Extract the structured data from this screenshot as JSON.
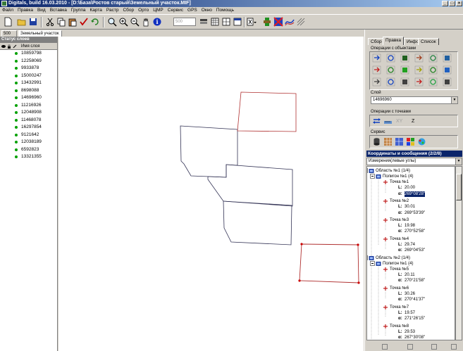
{
  "window": {
    "title": "Digitals, build 16.03.2010 - [D:\\База\\Ростов старый\\Земельный участок.MIF]"
  },
  "menu": [
    "Файл",
    "Правка",
    "Вид",
    "Вставка",
    "Группа",
    "Карта",
    "Растр",
    "Сбор",
    "Орто",
    "ЦМР",
    "Сервис",
    "GPS",
    "Окно",
    "Помощь"
  ],
  "toolbar": {
    "scale_placeholder": "500"
  },
  "doc_tabs": {
    "zoom": "500",
    "doc": "Земельный участок"
  },
  "layers_panel": {
    "title": "Статус слоев",
    "column": "Имя слоя",
    "layers": [
      "10859798",
      "12258069",
      "9933878",
      "15000247",
      "13432991",
      "8698088",
      "14696960",
      "11216926",
      "12048908",
      "11468078",
      "16297854",
      "9121642",
      "12038189",
      "6592823",
      "13321355"
    ]
  },
  "right_panel": {
    "tabs": [
      "Сбор",
      "Правка",
      "Инфо",
      "Список"
    ],
    "active_tab": "Правка",
    "object_ops_label": "Операции с объектами",
    "layer_label": "Слой",
    "layer_value": "14696960",
    "point_ops_label": "Операции с точками",
    "xyz_labels": [
      "XY",
      "Z"
    ],
    "service_label": "Сервис",
    "coords_title": "Координаты и сообщения (2/2/8)",
    "meas_combo": "Измерения(левые углы)"
  },
  "tree": {
    "area1": "Область №1 (1/4)",
    "poly1": "Полигон №1 (4)",
    "p1": "Точка №1",
    "p1_l": "20.00",
    "p1_a": "269°08'28\"",
    "p2": "Точка №2",
    "p2_l": "30.01",
    "p2_a": "269°53'39\"",
    "p3": "Точка №3",
    "p3_l": "19.98",
    "p3_a": "270°52'58\"",
    "p4": "Точка №4",
    "p4_l": "29.74",
    "p4_a": "269°04'53\"",
    "area2": "Область №2 (1/4)",
    "poly2": "Полигон №1 (4)",
    "p5": "Точка №5",
    "p5_l": "20.11",
    "p5_a": "270°21'58\"",
    "p6": "Точка №6",
    "p6_l": "30.26",
    "p6_a": "270°41'37\"",
    "p7": "Точка №7",
    "p7_l": "19.57",
    "p7_a": "271°26'15\"",
    "p8": "Точка №8",
    "p8_l": "29.53",
    "p8_a": "267°30'08\"",
    "l_label": "L:",
    "a_label": "α:"
  },
  "colors": {
    "selection": "#0a246a",
    "selected_polygon": "#cc0000",
    "parcel_line": "#333355",
    "layer_dot": "#00a000"
  }
}
